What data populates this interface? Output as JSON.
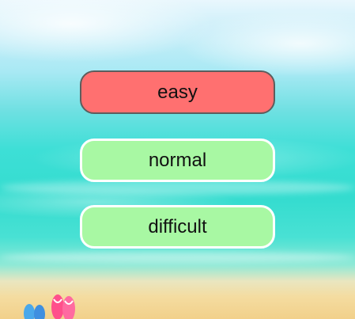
{
  "menu": {
    "buttons": [
      {
        "label": "easy",
        "selected": true
      },
      {
        "label": "normal",
        "selected": false
      },
      {
        "label": "difficult",
        "selected": false
      }
    ]
  },
  "colors": {
    "selected": "#ff7070",
    "unselected": "#a8f8a3"
  },
  "decoration": {
    "icon": "flip-flops-icon"
  }
}
